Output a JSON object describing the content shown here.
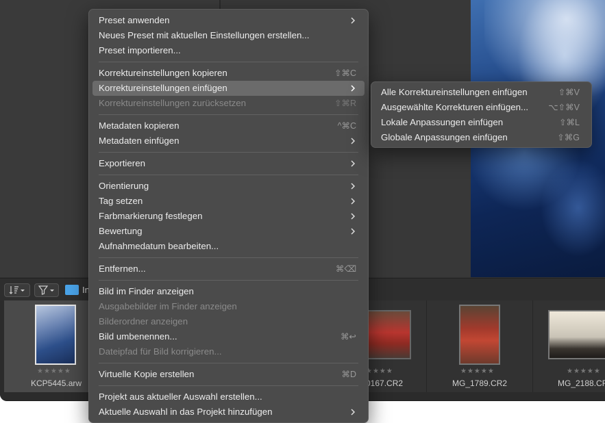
{
  "filmstrip": {
    "folder_label": "In",
    "items": [
      {
        "filename": "KCP5445.arw",
        "rating": "★★★★★"
      },
      {
        "filename": "0167.CR2",
        "rating": "★★★★"
      },
      {
        "filename": "MG_1789.CR2",
        "rating": "★★★★★"
      },
      {
        "filename": "MG_2188.CR",
        "rating": "★★★★★"
      }
    ]
  },
  "context_menu": {
    "items": [
      {
        "label": "Preset anwenden",
        "shortcut": "",
        "submenu": true,
        "disabled": false
      },
      {
        "label": "Neues Preset mit aktuellen Einstellungen erstellen...",
        "shortcut": "",
        "submenu": false,
        "disabled": false
      },
      {
        "label": "Preset importieren...",
        "shortcut": "",
        "submenu": false,
        "disabled": false
      },
      {
        "label": "Korrektureinstellungen kopieren",
        "shortcut": "⇧⌘C",
        "submenu": false,
        "disabled": false
      },
      {
        "label": "Korrektureinstellungen einfügen",
        "shortcut": "",
        "submenu": true,
        "disabled": false
      },
      {
        "label": "Korrektureinstellungen zurücksetzen",
        "shortcut": "⇧⌘R",
        "submenu": false,
        "disabled": true
      },
      {
        "label": "Metadaten kopieren",
        "shortcut": "^⌘C",
        "submenu": false,
        "disabled": false
      },
      {
        "label": "Metadaten einfügen",
        "shortcut": "",
        "submenu": true,
        "disabled": false
      },
      {
        "label": "Exportieren",
        "shortcut": "",
        "submenu": true,
        "disabled": false
      },
      {
        "label": "Orientierung",
        "shortcut": "",
        "submenu": true,
        "disabled": false
      },
      {
        "label": "Tag setzen",
        "shortcut": "",
        "submenu": true,
        "disabled": false
      },
      {
        "label": "Farbmarkierung festlegen",
        "shortcut": "",
        "submenu": true,
        "disabled": false
      },
      {
        "label": "Bewertung",
        "shortcut": "",
        "submenu": true,
        "disabled": false
      },
      {
        "label": "Aufnahmedatum bearbeiten...",
        "shortcut": "",
        "submenu": false,
        "disabled": false
      },
      {
        "label": "Entfernen...",
        "shortcut": "⌘⌫",
        "submenu": false,
        "disabled": false
      },
      {
        "label": "Bild im Finder anzeigen",
        "shortcut": "",
        "submenu": false,
        "disabled": false
      },
      {
        "label": "Ausgabebilder im Finder anzeigen",
        "shortcut": "",
        "submenu": false,
        "disabled": true
      },
      {
        "label": "Bilderordner anzeigen",
        "shortcut": "",
        "submenu": false,
        "disabled": true
      },
      {
        "label": "Bild umbenennen...",
        "shortcut": "⌘↩",
        "submenu": false,
        "disabled": false
      },
      {
        "label": "Dateipfad für Bild korrigieren...",
        "shortcut": "",
        "submenu": false,
        "disabled": true
      },
      {
        "label": "Virtuelle Kopie erstellen",
        "shortcut": "⌘D",
        "submenu": false,
        "disabled": false
      },
      {
        "label": "Projekt aus aktueller Auswahl erstellen...",
        "shortcut": "",
        "submenu": false,
        "disabled": false
      },
      {
        "label": "Aktuelle Auswahl in das Projekt hinzufügen",
        "shortcut": "",
        "submenu": true,
        "disabled": false
      }
    ]
  },
  "submenu": {
    "items": [
      {
        "label": "Alle Korrektureinstellungen einfügen",
        "shortcut": "⇧⌘V"
      },
      {
        "label": "Ausgewählte Korrekturen einfügen...",
        "shortcut": "⌥⇧⌘V"
      },
      {
        "label": "Lokale Anpassungen einfügen",
        "shortcut": "⇧⌘L"
      },
      {
        "label": "Globale Anpassungen einfügen",
        "shortcut": "⇧⌘G"
      }
    ]
  }
}
